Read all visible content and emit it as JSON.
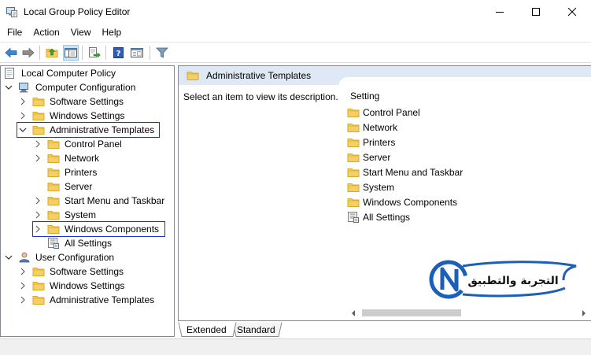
{
  "window": {
    "title": "Local Group Policy Editor",
    "controls": [
      "minimize-icon",
      "maximize-icon",
      "close-icon"
    ]
  },
  "menu": {
    "items": [
      {
        "label": "File"
      },
      {
        "label": "Action"
      },
      {
        "label": "View"
      },
      {
        "label": "Help"
      }
    ]
  },
  "toolbar": {
    "buttons": [
      "back-arrow-icon",
      "forward-arrow-icon",
      "up-folder-icon",
      "show-hide-tree-icon",
      "export-list-icon",
      "help-icon",
      "properties-icon",
      "filter-icon"
    ],
    "pressed": "show-hide-tree-icon"
  },
  "tree": {
    "root": "Local Computer Policy",
    "computer_config": "Computer Configuration",
    "cc_children": {
      "software": "Software Settings",
      "windows": "Windows Settings",
      "admin": "Administrative Templates"
    },
    "admin_children": {
      "control_panel": "Control Panel",
      "network": "Network",
      "printers": "Printers",
      "server": "Server",
      "start_menu": "Start Menu and Taskbar",
      "system": "System",
      "windows_components": "Windows Components",
      "all_settings": "All Settings"
    },
    "user_config": "User Configuration",
    "uc_children": {
      "software": "Software Settings",
      "windows": "Windows Settings",
      "admin": "Administrative Templates"
    },
    "highlighted": [
      "Administrative Templates",
      "Windows Components"
    ]
  },
  "details": {
    "header_title": "Administrative Templates",
    "description": "Select an item to view its description.",
    "column_header": "Setting",
    "items": [
      {
        "label": "Control Panel",
        "icon": "folder-icon"
      },
      {
        "label": "Network",
        "icon": "folder-icon"
      },
      {
        "label": "Printers",
        "icon": "folder-icon"
      },
      {
        "label": "Server",
        "icon": "folder-icon"
      },
      {
        "label": "Start Menu and Taskbar",
        "icon": "folder-icon"
      },
      {
        "label": "System",
        "icon": "folder-icon"
      },
      {
        "label": "Windows Components",
        "icon": "folder-icon"
      },
      {
        "label": "All Settings",
        "icon": "settings-list-icon"
      }
    ]
  },
  "tabs": {
    "extended": "Extended",
    "standard": "Standard",
    "active": "Extended"
  },
  "watermark": {
    "text": "التجربة والتطبيق",
    "letters": "CN",
    "accent": "#1b5fb8"
  },
  "colors": {
    "selection_box": "#1e2fd6",
    "header_bg": "#dfe9f5",
    "folder_yellow": "#f2c94c"
  }
}
